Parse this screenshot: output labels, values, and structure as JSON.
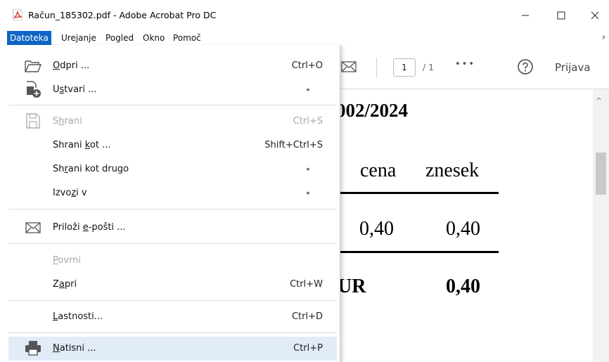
{
  "window": {
    "title": "Račun_185302.pdf - Adobe Acrobat Pro DC",
    "minimize_glyph": "—",
    "maximize_glyph": "☐",
    "close_glyph": "✕"
  },
  "menubar": {
    "items": [
      {
        "label": "Datoteka",
        "active": true
      },
      {
        "label": "Urejanje"
      },
      {
        "label": "Pogled"
      },
      {
        "label": "Okno"
      },
      {
        "label": "Pomoč"
      }
    ],
    "overflow_glyph": "›"
  },
  "toolbar": {
    "page_current": "1",
    "page_total": "/ 1",
    "more_glyph": "•••",
    "login_label": "Prijava"
  },
  "file_menu": {
    "items": [
      {
        "pre": "",
        "ul": "O",
        "post": "dpri ...",
        "shortcut": "Ctrl+O",
        "icon": "folder-open-icon"
      },
      {
        "pre": "U",
        "ul": "s",
        "post": "tvari ...",
        "submenu": "▸",
        "icon": "create-pdf-icon"
      },
      {
        "pre": "S",
        "ul": "h",
        "post": "rani",
        "shortcut": "Ctrl+S",
        "disabled": true,
        "icon": "save-icon"
      },
      {
        "pre": "Shrani ",
        "ul": "k",
        "post": "ot ...",
        "shortcut": "Shift+Ctrl+S"
      },
      {
        "pre": "Sh",
        "ul": "r",
        "post": "ani kot drugo",
        "submenu": "▸"
      },
      {
        "pre": "Izvo",
        "ul": "z",
        "post": "i v",
        "submenu": "▸"
      },
      {
        "pre": "Priloži ",
        "ul": "e",
        "post": "-pošti ...",
        "icon": "envelope-icon"
      },
      {
        "pre": "",
        "ul": "P",
        "post": "ovrni",
        "disabled": true
      },
      {
        "pre": "Z",
        "ul": "a",
        "post": "pri",
        "shortcut": "Ctrl+W"
      },
      {
        "pre": "",
        "ul": "L",
        "post": "astnosti...",
        "shortcut": "Ctrl+D"
      },
      {
        "pre": "",
        "ul": "N",
        "post": "atisni ...",
        "shortcut": "Ctrl+P",
        "icon": "printer-icon",
        "highlighted": true
      }
    ]
  },
  "document": {
    "invoice_number": "002/2024",
    "col_price": "cena",
    "col_amount": "znesek",
    "row_price": "0,40",
    "row_amount": "0,40",
    "total_label": "UR",
    "total_value": "0,40"
  },
  "colors": {
    "menu_active": "#0e66c4",
    "menu_highlight": "#e1ecf8",
    "pdf_icon": "#d7261c"
  }
}
